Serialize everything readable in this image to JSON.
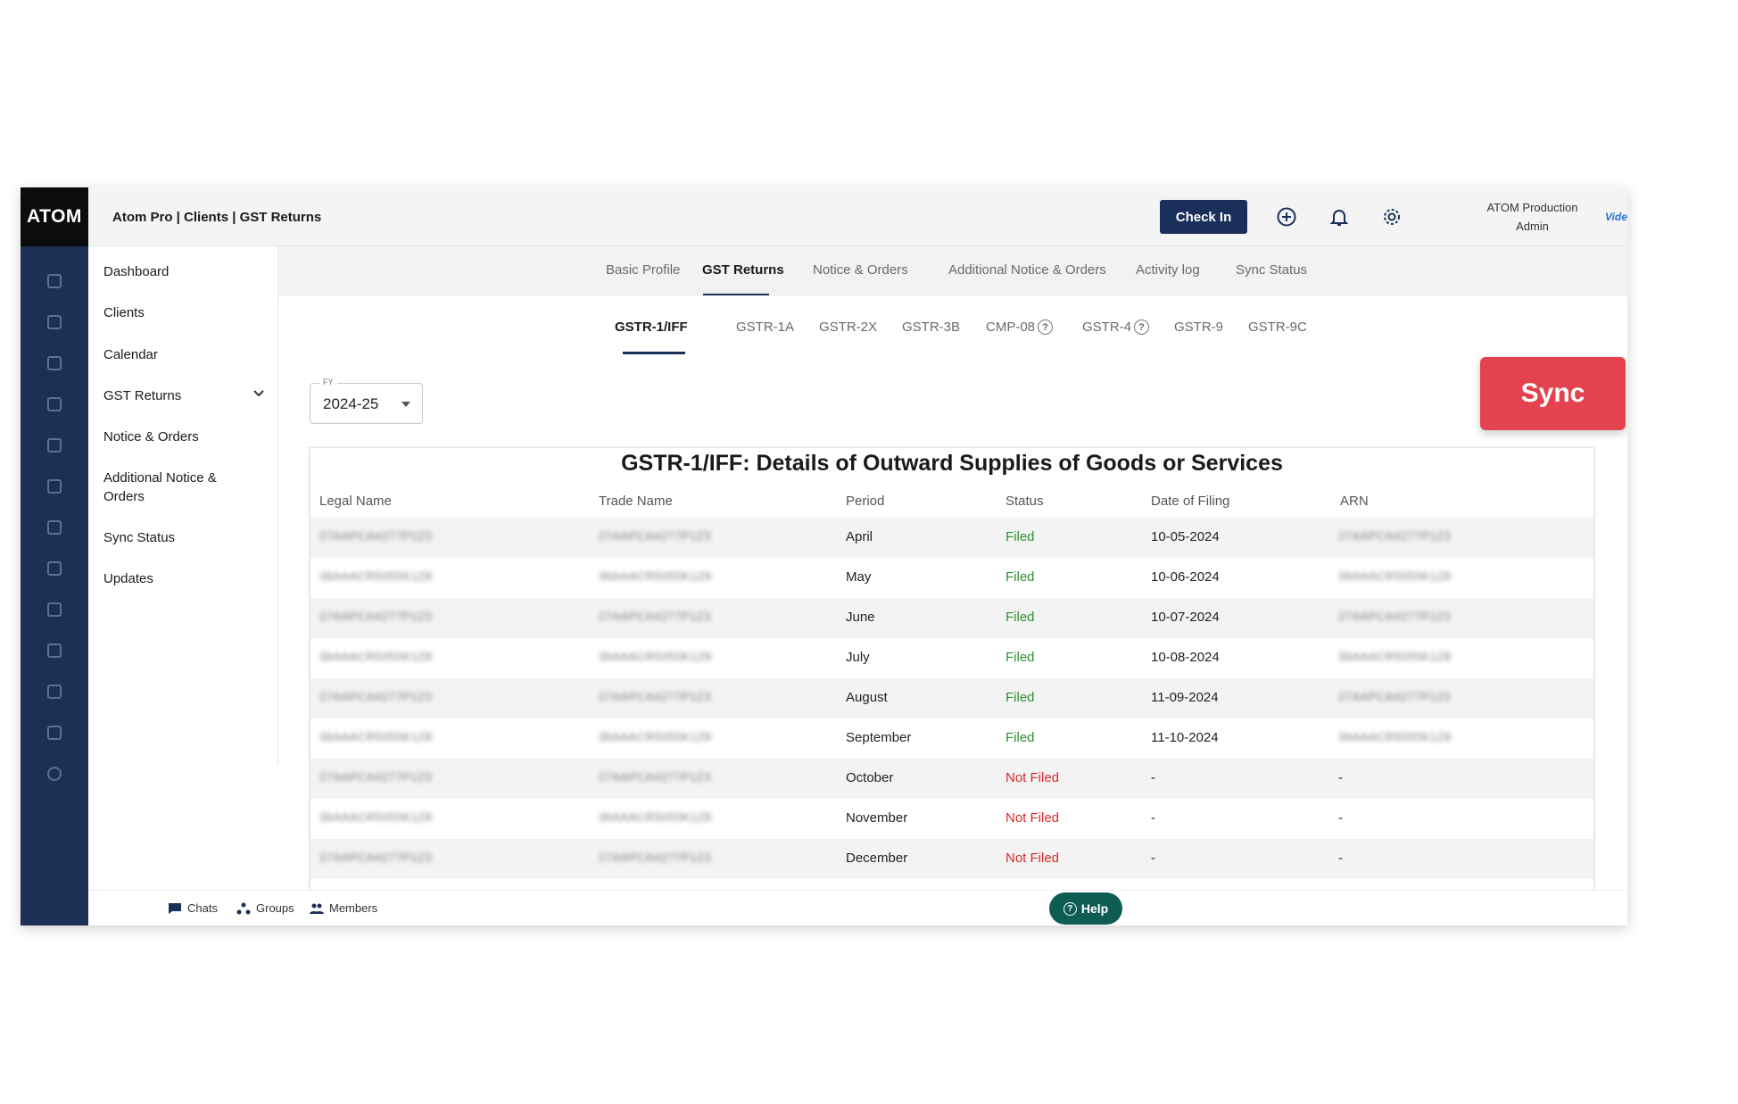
{
  "app": {
    "logo": "ATOM",
    "breadcrumb": "Atom Pro | Clients | GST Returns"
  },
  "header": {
    "checkin_label": "Check In",
    "user_name": "ATOM Production",
    "user_role": "Admin",
    "brand": "Vider"
  },
  "sidebar": {
    "items": [
      {
        "label": "Dashboard"
      },
      {
        "label": "Clients"
      },
      {
        "label": "Calendar"
      },
      {
        "label": "GST Returns"
      },
      {
        "label": "Notice & Orders"
      },
      {
        "label": "Additional Notice & Orders"
      },
      {
        "label": "Sync Status"
      },
      {
        "label": "Updates"
      }
    ]
  },
  "tabs": [
    {
      "label": "Basic Profile"
    },
    {
      "label": "GST Returns",
      "active": true
    },
    {
      "label": "Notice & Orders"
    },
    {
      "label": "Additional Notice & Orders"
    },
    {
      "label": "Activity log"
    },
    {
      "label": "Sync Status"
    }
  ],
  "subtabs": [
    {
      "label": "GSTR-1/IFF",
      "active": true
    },
    {
      "label": "GSTR-1A"
    },
    {
      "label": "GSTR-2X"
    },
    {
      "label": "GSTR-3B"
    },
    {
      "label": "CMP-08",
      "help": true
    },
    {
      "label": "GSTR-4",
      "help": true
    },
    {
      "label": "GSTR-9"
    },
    {
      "label": "GSTR-9C"
    }
  ],
  "fy": {
    "label": "FY",
    "value": "2024-25"
  },
  "sync_label": "Sync",
  "table": {
    "title": "GSTR-1/IFF: Details of Outward Supplies of Goods or Services",
    "columns": [
      "Legal Name",
      "Trade Name",
      "Period",
      "Status",
      "Date of Filing",
      "ARN"
    ],
    "rows": [
      {
        "legal": "27AAPCA4277P1Z3",
        "trade": "27AAPCA4277P1Z3",
        "period": "April",
        "status": "Filed",
        "date": "10-05-2024",
        "arn": "27AAPCA4277P1Z3"
      },
      {
        "legal": "36AAACR5055K1Z8",
        "trade": "36AAACR5055K1Z8",
        "period": "May",
        "status": "Filed",
        "date": "10-06-2024",
        "arn": "36AAACR5055K1Z8"
      },
      {
        "legal": "27AAPCA4277P1Z3",
        "trade": "27AAPCA4277P1Z3",
        "period": "June",
        "status": "Filed",
        "date": "10-07-2024",
        "arn": "27AAPCA4277P1Z3"
      },
      {
        "legal": "36AAACR5055K1Z8",
        "trade": "36AAACR5055K1Z8",
        "period": "July",
        "status": "Filed",
        "date": "10-08-2024",
        "arn": "36AAACR5055K1Z8"
      },
      {
        "legal": "27AAPCA4277P1Z3",
        "trade": "27AAPCA4277P1Z3",
        "period": "August",
        "status": "Filed",
        "date": "11-09-2024",
        "arn": "27AAPCA4277P1Z3"
      },
      {
        "legal": "36AAACR5055K1Z8",
        "trade": "36AAACR5055K1Z8",
        "period": "September",
        "status": "Filed",
        "date": "11-10-2024",
        "arn": "36AAACR5055K1Z8"
      },
      {
        "legal": "27AAPCA4277P1Z3",
        "trade": "27AAPCA4277P1Z3",
        "period": "October",
        "status": "Not Filed",
        "date": "-",
        "arn": "-"
      },
      {
        "legal": "36AAACR5055K1Z8",
        "trade": "36AAACR5055K1Z8",
        "period": "November",
        "status": "Not Filed",
        "date": "-",
        "arn": "-"
      },
      {
        "legal": "27AAPCA4277P1Z3",
        "trade": "27AAPCA4277P1Z3",
        "period": "December",
        "status": "Not Filed",
        "date": "-",
        "arn": "-"
      }
    ]
  },
  "footer": {
    "chats": "Chats",
    "groups": "Groups",
    "members": "Members",
    "help": "Help"
  },
  "colors": {
    "navy": "#1b2f5b",
    "rail": "#1e2f55",
    "sync": "#e5424f",
    "filed": "#2f8f2f",
    "not_filed": "#d62a2a",
    "help": "#0f5c55"
  }
}
